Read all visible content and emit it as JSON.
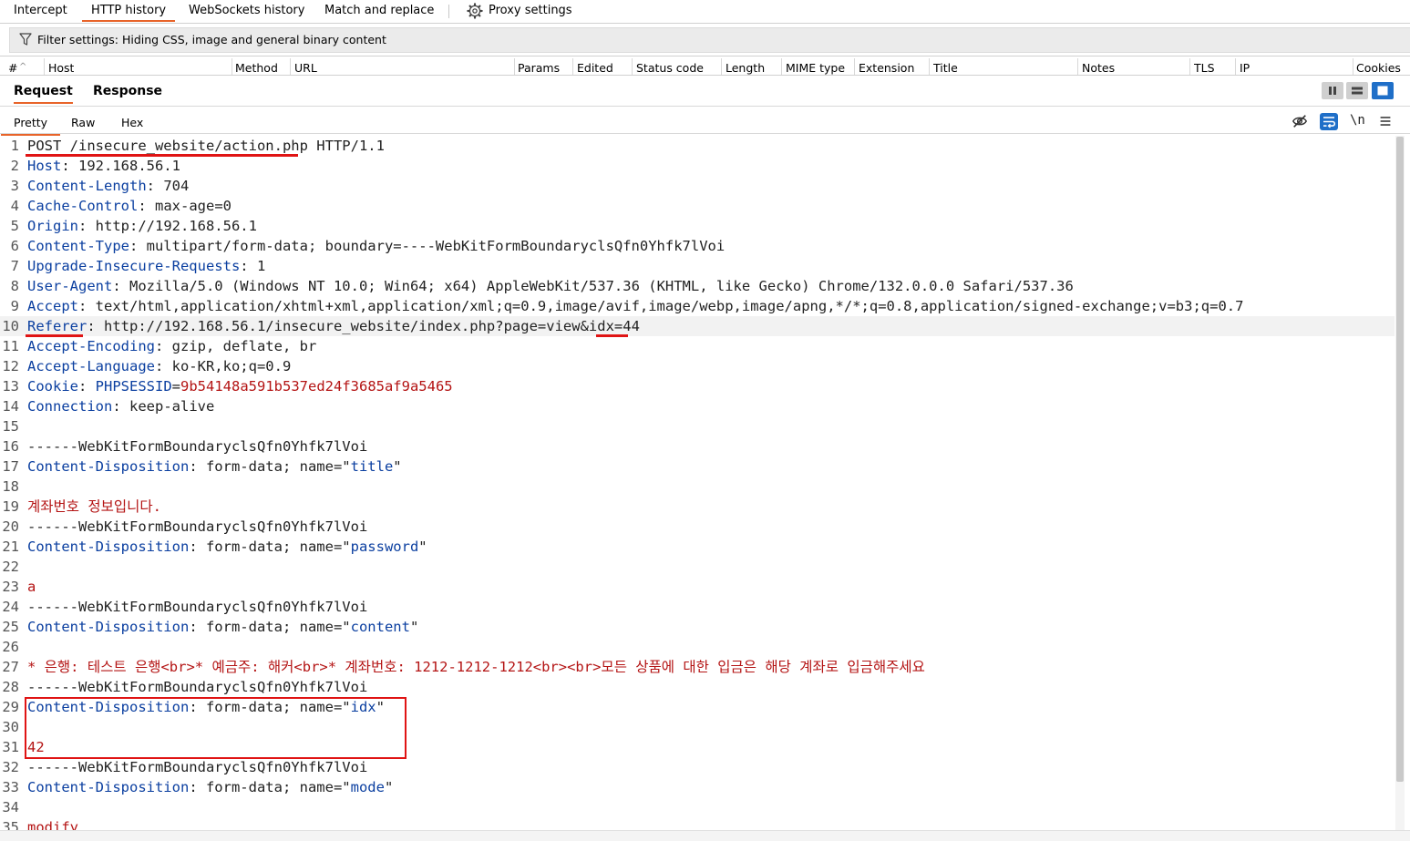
{
  "top_tabs": [
    {
      "label": "Intercept",
      "active": false
    },
    {
      "label": "HTTP history",
      "active": true
    },
    {
      "label": "WebSockets history",
      "active": false
    },
    {
      "label": "Match and replace",
      "active": false
    },
    {
      "label": "Proxy settings",
      "active": false
    }
  ],
  "filter": {
    "text": "Filter settings: Hiding CSS, image and general binary content"
  },
  "columns": [
    "#",
    "Host",
    "Method",
    "URL",
    "Params",
    "Edited",
    "Status code",
    "Length",
    "MIME type",
    "Extension",
    "Title",
    "Notes",
    "TLS",
    "IP",
    "Cookies"
  ],
  "sort_indicator": "^",
  "panel_tabs": [
    {
      "label": "Request",
      "active": true
    },
    {
      "label": "Response",
      "active": false
    }
  ],
  "sub_tabs": [
    {
      "label": "Pretty",
      "active": true
    },
    {
      "label": "Raw",
      "active": false
    },
    {
      "label": "Hex",
      "active": false
    }
  ],
  "toolbar": {
    "newline_label": "\\n"
  },
  "icons": {
    "gear": "gear-icon",
    "filter": "funnel-icon",
    "hide": "eye-off-icon",
    "wrap": "word-wrap-icon",
    "menu": "hamburger-menu-icon"
  },
  "colors": {
    "accent": "#e8642a",
    "header_key": "#0b3fa0",
    "string_value": "#b41414",
    "annotation": "#e01414",
    "active_view": "#1f6fc8"
  },
  "highlighted_line": 10,
  "request_lines": [
    [
      {
        "t": "POST /insecure_website/action.php",
        "c": "p"
      },
      {
        "t": " HTTP/1.1",
        "c": "p"
      }
    ],
    [
      {
        "t": "Host",
        "c": "k"
      },
      {
        "t": ": 192.168.56.1",
        "c": "v"
      }
    ],
    [
      {
        "t": "Content-Length",
        "c": "k"
      },
      {
        "t": ": 704",
        "c": "v"
      }
    ],
    [
      {
        "t": "Cache-Control",
        "c": "k"
      },
      {
        "t": ": max-age=0",
        "c": "v"
      }
    ],
    [
      {
        "t": "Origin",
        "c": "k"
      },
      {
        "t": ": http://192.168.56.1",
        "c": "v"
      }
    ],
    [
      {
        "t": "Content-Type",
        "c": "k"
      },
      {
        "t": ": multipart/form-data; boundary=----WebKitFormBoundaryclsQfn0Yhfk7lVoi",
        "c": "v"
      }
    ],
    [
      {
        "t": "Upgrade-Insecure-Requests",
        "c": "k"
      },
      {
        "t": ": 1",
        "c": "v"
      }
    ],
    [
      {
        "t": "User-Agent",
        "c": "k"
      },
      {
        "t": ": Mozilla/5.0 (Windows NT 10.0; Win64; x64) AppleWebKit/537.36 (KHTML, like Gecko) Chrome/132.0.0.0 Safari/537.36",
        "c": "v"
      }
    ],
    [
      {
        "t": "Accept",
        "c": "k"
      },
      {
        "t": ": text/html,application/xhtml+xml,application/xml;q=0.9,image/avif,image/webp,image/apng,*/*;q=0.8,application/signed-exchange;v=b3;q=0.7",
        "c": "v"
      }
    ],
    [
      {
        "t": "Referer",
        "c": "k"
      },
      {
        "t": ": http://192.168.56.1/insecure_website/index.php?page=view&idx=44",
        "c": "v"
      }
    ],
    [
      {
        "t": "Accept-Encoding",
        "c": "k"
      },
      {
        "t": ": gzip, deflate, br",
        "c": "v"
      }
    ],
    [
      {
        "t": "Accept-Language",
        "c": "k"
      },
      {
        "t": ": ko-KR,ko;q=0.9",
        "c": "v"
      }
    ],
    [
      {
        "t": "Cookie",
        "c": "k"
      },
      {
        "t": ": ",
        "c": "v"
      },
      {
        "t": "PHPSESSID",
        "c": "k"
      },
      {
        "t": "=",
        "c": "v"
      },
      {
        "t": "9b54148a591b537ed24f3685af9a5465",
        "c": "s"
      }
    ],
    [
      {
        "t": "Connection",
        "c": "k"
      },
      {
        "t": ": keep-alive",
        "c": "v"
      }
    ],
    [],
    [
      {
        "t": "------WebKitFormBoundaryclsQfn0Yhfk7lVoi",
        "c": "v"
      }
    ],
    [
      {
        "t": "Content-Disposition",
        "c": "k"
      },
      {
        "t": ": form-data; name=\"",
        "c": "v"
      },
      {
        "t": "title",
        "c": "k"
      },
      {
        "t": "\"",
        "c": "v"
      }
    ],
    [],
    [
      {
        "t": "계좌번호 정보입니다.",
        "c": "s"
      }
    ],
    [
      {
        "t": "------WebKitFormBoundaryclsQfn0Yhfk7lVoi",
        "c": "v"
      }
    ],
    [
      {
        "t": "Content-Disposition",
        "c": "k"
      },
      {
        "t": ": form-data; name=\"",
        "c": "v"
      },
      {
        "t": "password",
        "c": "k"
      },
      {
        "t": "\"",
        "c": "v"
      }
    ],
    [],
    [
      {
        "t": "a",
        "c": "s"
      }
    ],
    [
      {
        "t": "------WebKitFormBoundaryclsQfn0Yhfk7lVoi",
        "c": "v"
      }
    ],
    [
      {
        "t": "Content-Disposition",
        "c": "k"
      },
      {
        "t": ": form-data; name=\"",
        "c": "v"
      },
      {
        "t": "content",
        "c": "k"
      },
      {
        "t": "\"",
        "c": "v"
      }
    ],
    [],
    [
      {
        "t": "* 은행: 테스트 은행<br>* 예금주: 해커<br>* 계좌번호: 1212-1212-1212<br><br>모든 상품에 대한 입금은 해당 계좌로 입금해주세요",
        "c": "s"
      }
    ],
    [
      {
        "t": "------WebKitFormBoundaryclsQfn0Yhfk7lVoi",
        "c": "v"
      }
    ],
    [
      {
        "t": "Content-Disposition",
        "c": "k"
      },
      {
        "t": ": form-data; name=\"",
        "c": "v"
      },
      {
        "t": "idx",
        "c": "k"
      },
      {
        "t": "\"",
        "c": "v"
      }
    ],
    [],
    [
      {
        "t": "42",
        "c": "s"
      }
    ],
    [
      {
        "t": "------WebKitFormBoundaryclsQfn0Yhfk7lVoi",
        "c": "v"
      }
    ],
    [
      {
        "t": "Content-Disposition",
        "c": "k"
      },
      {
        "t": ": form-data; name=\"",
        "c": "v"
      },
      {
        "t": "mode",
        "c": "k"
      },
      {
        "t": "\"",
        "c": "v"
      }
    ],
    [],
    [
      {
        "t": "modify",
        "c": "s"
      }
    ]
  ]
}
